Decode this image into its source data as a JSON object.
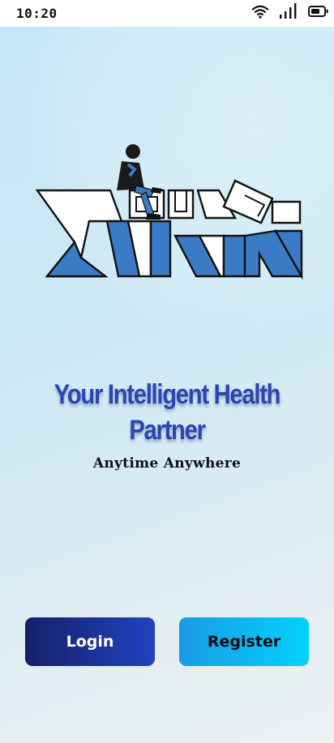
{
  "status_bar": {
    "time": "10:20"
  },
  "main": {
    "tagline": "Your Intelligent Health Partner",
    "subtagline": "Anytime Anywhere"
  },
  "actions": {
    "login_label": "Login",
    "register_label": "Register"
  },
  "colors": {
    "brand_blue": "#2a45b4",
    "login_button": "#15206a",
    "register_button": "#03d2fb",
    "logo_fill": "#3a7bc6"
  },
  "icons": [
    "wifi-icon",
    "signal-icon",
    "battery-icon",
    "app-logo"
  ]
}
